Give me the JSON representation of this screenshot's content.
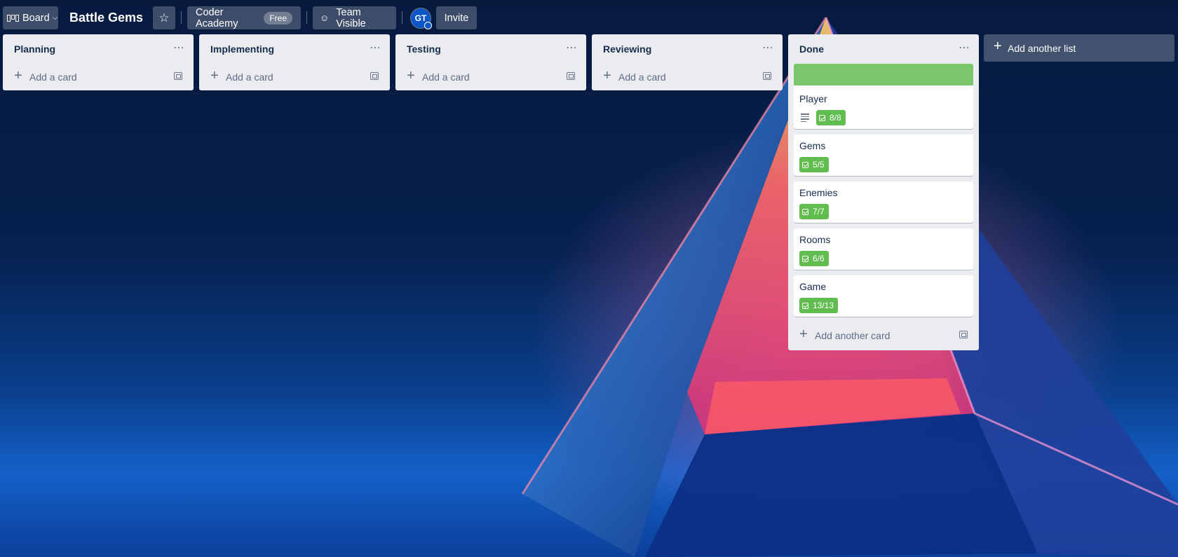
{
  "header": {
    "view_label": "Board",
    "board_title": "Battle Gems",
    "workspace_name": "Coder Academy",
    "workspace_plan": "Free",
    "visibility_label": "Team Visible",
    "avatar_initials": "GT",
    "invite_label": "Invite"
  },
  "lists": [
    {
      "title": "Planning",
      "add_label": "Add a card"
    },
    {
      "title": "Implementing",
      "add_label": "Add a card"
    },
    {
      "title": "Testing",
      "add_label": "Add a card"
    },
    {
      "title": "Reviewing",
      "add_label": "Add a card"
    },
    {
      "title": "Done",
      "add_label": "Add another card",
      "cover_color": "#7bc86c",
      "cards": [
        {
          "title": "Player",
          "checklist": "8/8",
          "has_description": true
        },
        {
          "title": "Gems",
          "checklist": "5/5"
        },
        {
          "title": "Enemies",
          "checklist": "7/7"
        },
        {
          "title": "Rooms",
          "checklist": "6/6"
        },
        {
          "title": "Game",
          "checklist": "13/13"
        }
      ]
    }
  ],
  "add_list_label": "Add another list",
  "colors": {
    "list_bg": "#ebecf0",
    "checklist_complete": "#61bd4f",
    "text_primary": "#172b4d"
  },
  "icons": {
    "board": "board-icon",
    "star": "star-icon",
    "visibility": "team-icon",
    "menu": "ellipsis-icon",
    "template": "card-template-icon",
    "checklist": "checklist-icon",
    "description": "description-icon"
  }
}
